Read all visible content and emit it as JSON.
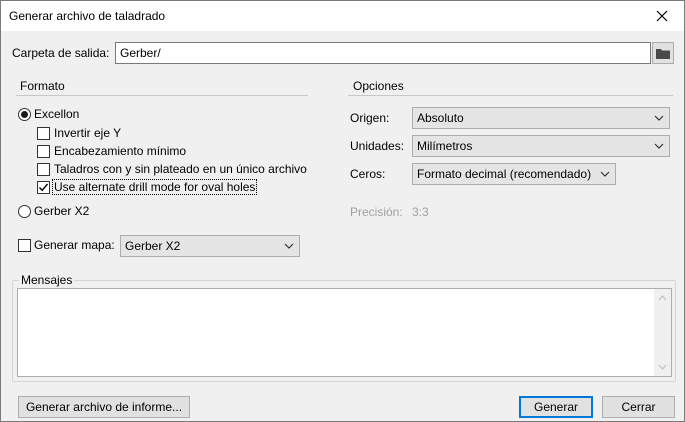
{
  "window": {
    "title": "Generar archivo de taladrado"
  },
  "output": {
    "label": "Carpeta de salida:",
    "value": "Gerber/"
  },
  "format": {
    "title": "Formato",
    "excellon_label": "Excellon",
    "excellon_selected": true,
    "options": [
      {
        "label": "Invertir eje Y",
        "checked": false
      },
      {
        "label": "Encabezamiento mínimo",
        "checked": false
      },
      {
        "label": "Taladros con y sin plateado en un único archivo",
        "checked": false
      },
      {
        "label": "Use alternate drill mode for oval holes",
        "checked": true
      }
    ],
    "gerber_label": "Gerber X2",
    "gerber_selected": false
  },
  "map": {
    "label": "Generar mapa:",
    "checked": false,
    "value": "Gerber X2"
  },
  "options": {
    "title": "Opciones",
    "origin_label": "Origen:",
    "origin_value": "Absoluto",
    "units_label": "Unidades:",
    "units_value": "Milímetros",
    "zeros_label": "Ceros:",
    "zeros_value": "Formato decimal (recomendado)",
    "precision_label": "Precisión:",
    "precision_value": "3:3"
  },
  "messages": {
    "title": "Mensajes",
    "content": ""
  },
  "buttons": {
    "report": "Generar archivo de informe...",
    "generate": "Generar",
    "cancel": "Cerrar"
  },
  "icons": {
    "close": "close-icon",
    "folder": "folder-icon",
    "dropdown": "chevron-down-icon"
  }
}
